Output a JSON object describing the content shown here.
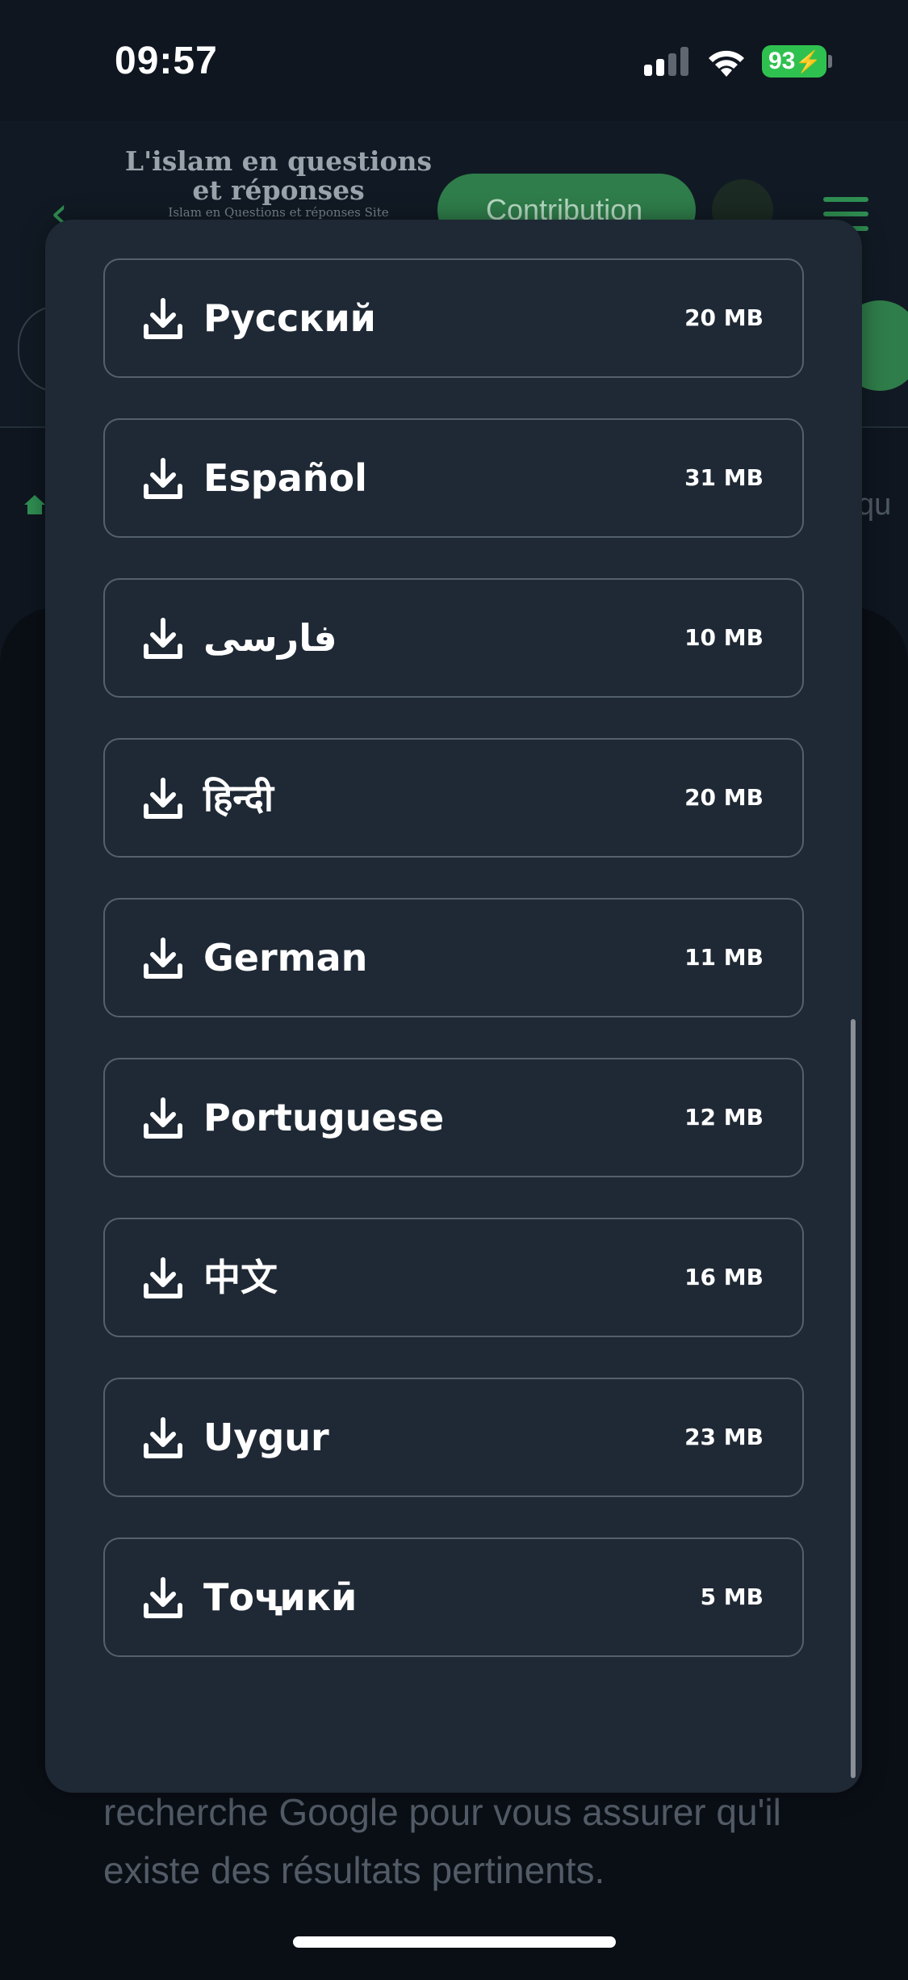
{
  "status_bar": {
    "time": "09:57",
    "battery": "93"
  },
  "background": {
    "logo_title": "L'islam en questions et réponses",
    "logo_subtitle": "Islam en Questions et réponses Site",
    "contribution_label": "Contribution",
    "breadcrumb_tail": "qu",
    "body_text": "recherche Google pour vous assurer qu'il existe des résultats pertinents."
  },
  "downloads": [
    {
      "label": "Русский",
      "size": "20 MB"
    },
    {
      "label": "Español",
      "size": "31 MB"
    },
    {
      "label": "فارسی",
      "size": "10 MB"
    },
    {
      "label": "हिन्दी",
      "size": "20 MB"
    },
    {
      "label": "German",
      "size": "11 MB"
    },
    {
      "label": "Portuguese",
      "size": "12 MB"
    },
    {
      "label": "中文",
      "size": "16 MB"
    },
    {
      "label": "Uygur",
      "size": "23 MB"
    },
    {
      "label": "Тоҷикӣ",
      "size": "5 MB"
    }
  ],
  "icons": {
    "download": "download-icon",
    "signal": "cellular-signal-icon",
    "wifi": "wifi-icon",
    "battery": "battery-icon"
  },
  "colors": {
    "modal_bg": "#1f2935",
    "item_border": "#55606d",
    "accent_green": "#2f7d4a",
    "battery_green": "#2fc14f"
  }
}
